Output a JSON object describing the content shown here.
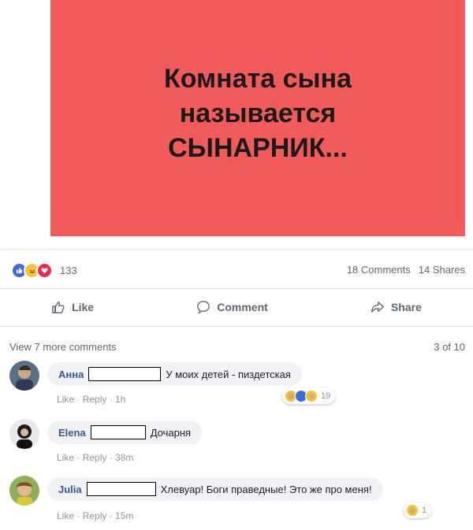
{
  "post": {
    "image_text": "Комната сына\nназывается\nСЫНАРНИК...",
    "background_color": "#f35a5a"
  },
  "reactions": {
    "icons": [
      "like-icon",
      "haha-icon",
      "love-icon"
    ],
    "count": "133",
    "comments": "18 Comments",
    "shares": "14 Shares"
  },
  "actions": {
    "like": "Like",
    "comment": "Comment",
    "share": "Share"
  },
  "comments_header": {
    "view_more": "View 7 more comments",
    "position": "3 of 10"
  },
  "comments": [
    {
      "name": "Анна",
      "text": "У моих детей - пиздетская",
      "like": "Like",
      "reply": "Reply",
      "time": "1h",
      "reactions": [
        "haha-icon",
        "like-icon",
        "wow-icon"
      ],
      "reaction_count": "19"
    },
    {
      "name": "Elena",
      "text": "Дочарня",
      "like": "Like",
      "reply": "Reply",
      "time": "38m"
    },
    {
      "name": "Julia",
      "text": "Хлевуар! Боги праведные! Это же про меня!",
      "like": "Like",
      "reply": "Reply",
      "time": "15m",
      "reactions": [
        "haha-icon"
      ],
      "reaction_count": "1"
    }
  ]
}
